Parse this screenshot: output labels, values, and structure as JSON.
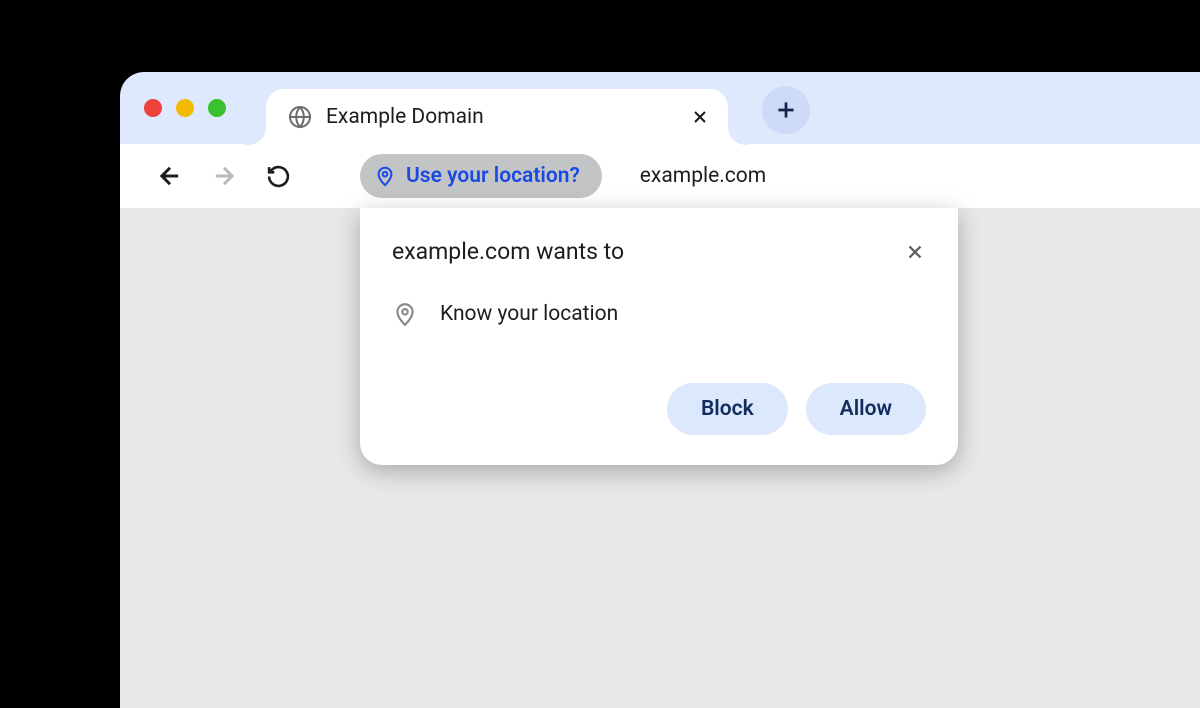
{
  "tab": {
    "title": "Example Domain"
  },
  "address": {
    "chip_text": "Use your location?",
    "url": "example.com"
  },
  "popup": {
    "title": "example.com wants to",
    "permission_text": "Know your location",
    "block_label": "Block",
    "allow_label": "Allow"
  }
}
